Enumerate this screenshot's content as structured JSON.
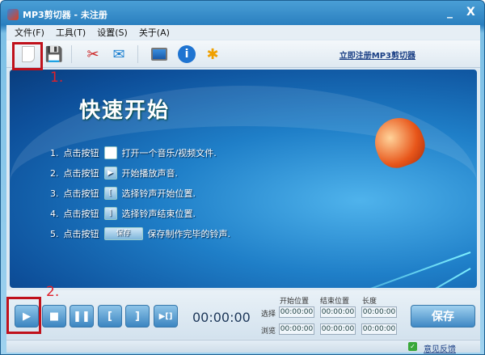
{
  "window": {
    "title": "MP3剪切器 - 未注册",
    "minimize": "_",
    "close": "X"
  },
  "menu": [
    "文件(F)",
    "工具(T)",
    "设置(S)",
    "关于(A)"
  ],
  "toolbar": {
    "register_link": "立即注册MP3剪切器"
  },
  "quickstart": {
    "title": "快速开始",
    "steps": [
      {
        "num": "1.",
        "prefix": "点击按钮",
        "text": "打开一个音乐/视频文件."
      },
      {
        "num": "2.",
        "prefix": "点击按钮",
        "text": "开始播放声音."
      },
      {
        "num": "3.",
        "prefix": "点击按钮",
        "text": "选择铃声开始位置."
      },
      {
        "num": "4.",
        "prefix": "点击按钮",
        "text": "选择铃声结束位置."
      },
      {
        "num": "5.",
        "prefix": "点击按钮",
        "text": "保存制作完毕的铃声.",
        "button": "保存"
      }
    ]
  },
  "controls": {
    "time": "00:00:00",
    "headers": [
      "开始位置",
      "结束位置",
      "长度"
    ],
    "rows": [
      {
        "label": "选择",
        "values": [
          "00:00:00",
          "00:00:00",
          "00:00:00"
        ]
      },
      {
        "label": "浏览",
        "values": [
          "00:00:00",
          "00:00:00",
          "00:00:00"
        ]
      }
    ],
    "save": "保存"
  },
  "status": {
    "feedback": "意见反馈"
  },
  "annotations": {
    "one": "1.",
    "two": "2."
  }
}
